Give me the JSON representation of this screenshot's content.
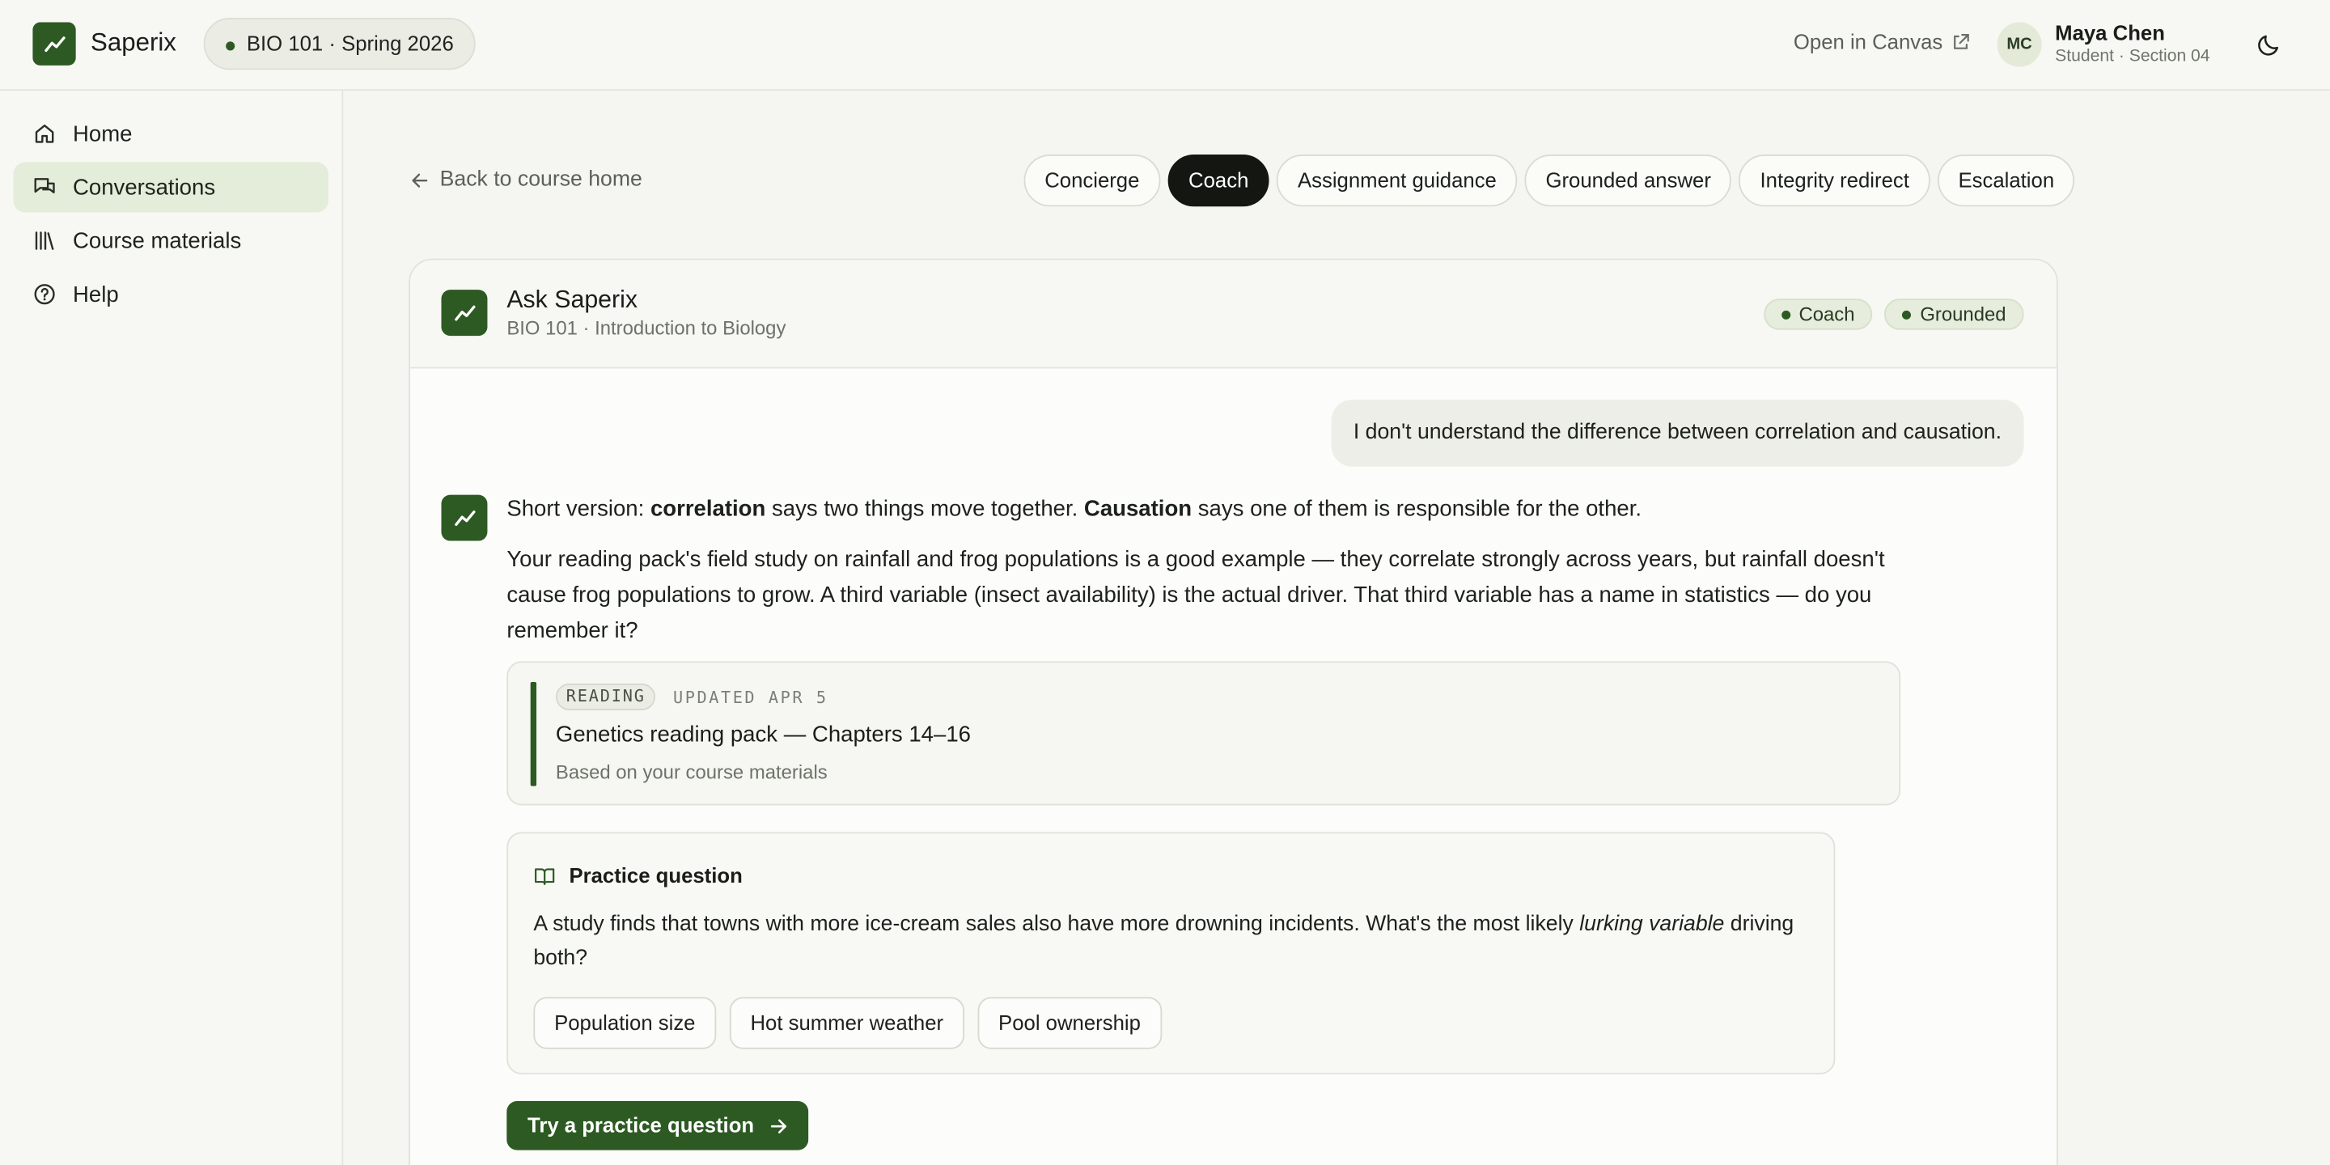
{
  "app": {
    "brand": "Saperix",
    "course_pill": "BIO 101 · Spring 2026",
    "open_canvas": "Open in Canvas",
    "user": {
      "initials": "MC",
      "name": "Maya Chen",
      "role": "Student · Section 04"
    }
  },
  "sidebar": {
    "items": [
      {
        "label": "Home",
        "icon": "home-icon"
      },
      {
        "label": "Conversations",
        "icon": "chat-icon",
        "active": true
      },
      {
        "label": "Course materials",
        "icon": "library-icon"
      },
      {
        "label": "Help",
        "icon": "help-icon"
      }
    ]
  },
  "main": {
    "back_label": "Back to course home",
    "tabs": [
      {
        "label": "Concierge"
      },
      {
        "label": "Coach",
        "active": true
      },
      {
        "label": "Assignment guidance"
      },
      {
        "label": "Grounded answer"
      },
      {
        "label": "Integrity redirect"
      },
      {
        "label": "Escalation"
      }
    ]
  },
  "chat": {
    "title": "Ask Saperix",
    "subtitle": "BIO 101 · Introduction to Biology",
    "badges": [
      "Coach",
      "Grounded"
    ],
    "user_message": "I don't understand the difference between correlation and causation.",
    "bot": {
      "line1_prefix": "Short version: ",
      "line1_term1": "correlation",
      "line1_mid": " says two things move together. ",
      "line1_term2": "Causation",
      "line1_suffix": " says one of them is responsible for the other.",
      "paragraph": "Your reading pack's field study on rainfall and frog populations is a good example — they correlate strongly across years, but rainfall doesn't cause frog populations to grow. A third variable (insect availability) is the actual driver. That third variable has a name in statistics — do you remember it?"
    },
    "source": {
      "tag": "READING",
      "updated": "UPDATED APR 5",
      "title": "Genetics reading pack — Chapters 14–16",
      "subtitle": "Based on your course materials"
    },
    "practice": {
      "heading": "Practice question",
      "text_prefix": "A study finds that towns with more ice-cream sales also have more drowning incidents. What's the most likely ",
      "text_italic": "lurking variable",
      "text_suffix": " driving both?",
      "options": [
        "Population size",
        "Hot summer weather",
        "Pool ownership"
      ]
    },
    "cta": "Try a practice question"
  },
  "colors": {
    "accent": "#2d5a23",
    "accent_soft": "#e4edda",
    "background": "#f5f6f1"
  }
}
